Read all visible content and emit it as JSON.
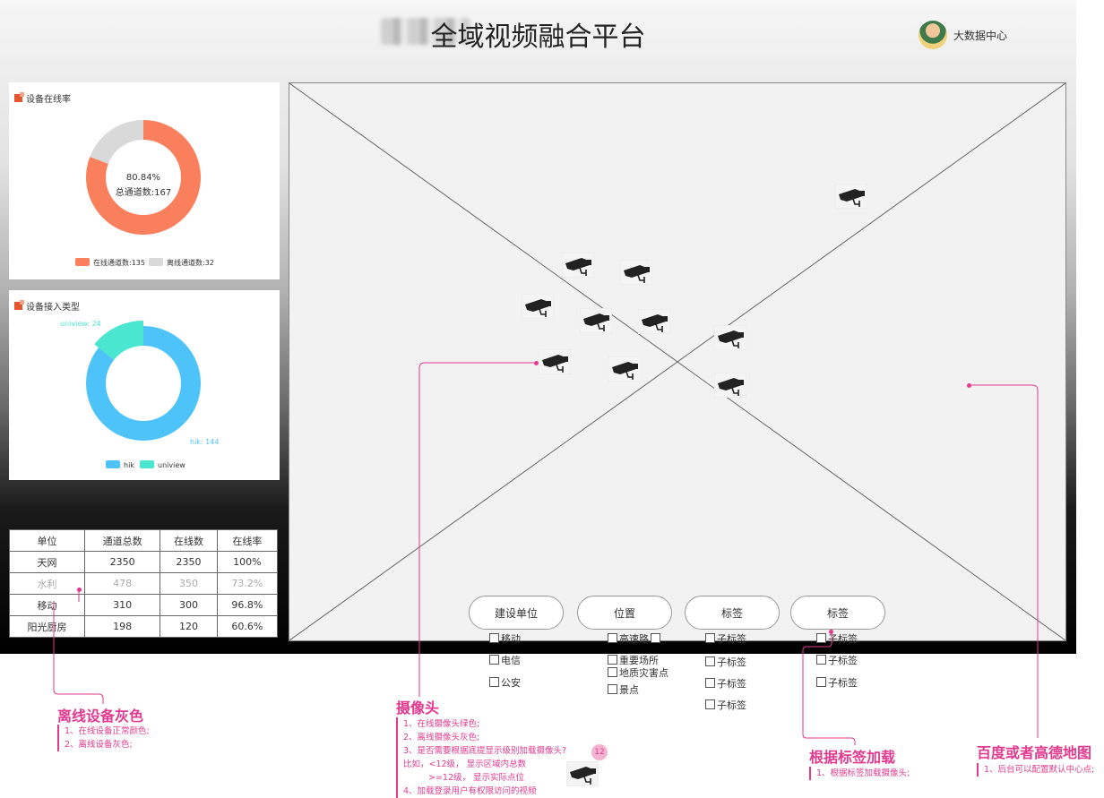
{
  "header": {
    "title": "全域视频融合平台",
    "user_name": "大数据中心"
  },
  "online_panel": {
    "title": "设备在线率",
    "center_percent": "80.84%",
    "center_total": "总通道数:167",
    "legend": [
      "在线通道数:135",
      "离线通道数:32"
    ],
    "colors": {
      "online": "#fa7f5c",
      "offline": "#d9d9d9"
    }
  },
  "type_panel": {
    "title": "设备接入类型",
    "label_uniview": "uniview: 24",
    "label_hik": "hik: 144",
    "legend": [
      "hik",
      "uniview"
    ],
    "colors": {
      "hik": "#4dc3fa",
      "uniview": "#4be6cf"
    }
  },
  "chart_data": [
    {
      "type": "pie",
      "title": "设备在线率",
      "categories": [
        "在线通道数",
        "离线通道数"
      ],
      "values": [
        135,
        32
      ]
    },
    {
      "type": "pie",
      "title": "设备接入类型",
      "categories": [
        "hik",
        "uniview"
      ],
      "values": [
        144,
        24
      ]
    }
  ],
  "table": {
    "headers": [
      "单位",
      "通道总数",
      "在线数",
      "在线率"
    ],
    "rows": [
      [
        "天网",
        "2350",
        "2350",
        "100%"
      ],
      [
        "水利",
        "478",
        "350",
        "73.2%"
      ],
      [
        "移动",
        "310",
        "300",
        "96.8%"
      ],
      [
        "阳光厨房",
        "198",
        "120",
        "60.6%"
      ]
    ]
  },
  "filters": {
    "pills": [
      "建设单位",
      "位置",
      "标签",
      "标签"
    ],
    "col1": [
      "移动",
      "电信",
      "公安"
    ],
    "col2": [
      "高速路",
      "重要场所",
      "地质灾害点",
      "景点"
    ],
    "col3": [
      "子标签",
      "子标签",
      "子标签",
      "子标签"
    ],
    "col4": [
      "子标签",
      "子标签",
      "子标签"
    ]
  },
  "annotations": {
    "offline": {
      "title": "离线设备灰色",
      "lines": [
        "1、在线设备正常颜色;",
        "2、离线设备灰色;"
      ]
    },
    "camera": {
      "title": "摄像头",
      "lines": [
        "1、在线摄像头绿色;",
        "2、离线摄像头灰色;",
        "3、是否需要根据底提显示级别加载摄像头?",
        "比如，<12级， 显示区域内总数",
        ">=12级， 显示实际点位",
        "4、加载登录用户有权限访问的视频"
      ],
      "badge": "12"
    },
    "tag": {
      "title": "根据标签加载",
      "lines": [
        "1、根据标签加载摄像头;"
      ]
    },
    "map": {
      "title": "百度或者高德地图",
      "lines": [
        "1、后台可以配置默认中心点;"
      ]
    }
  }
}
